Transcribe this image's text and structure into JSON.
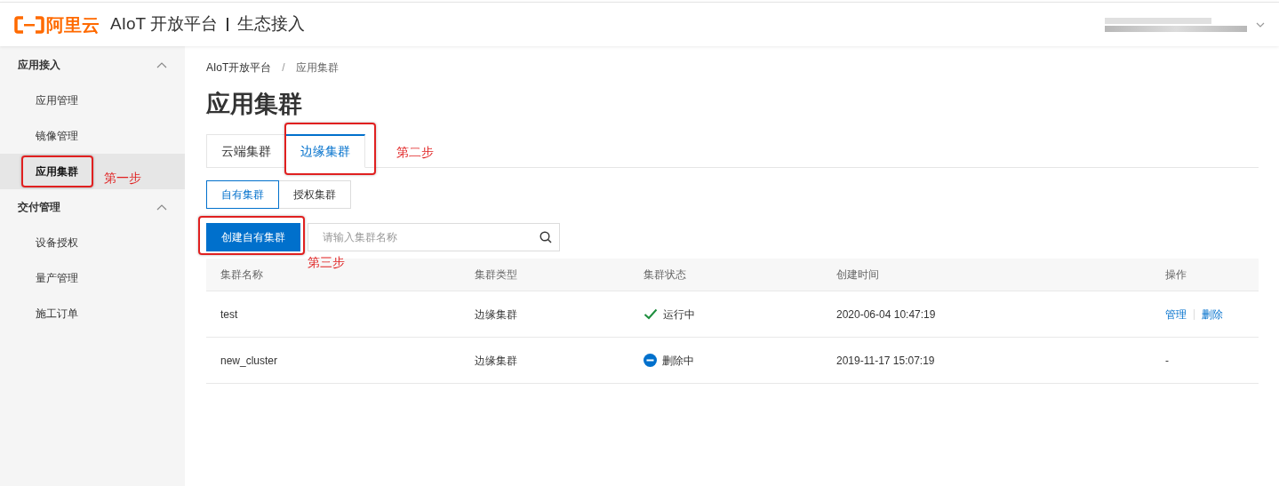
{
  "header": {
    "brand": "阿里云",
    "title": "AIoT 开放平台",
    "subtitle": "生态接入"
  },
  "sidebar": [
    {
      "label": "应用接入",
      "expanded": true,
      "items": [
        {
          "label": "应用管理",
          "selected": false
        },
        {
          "label": "镜像管理",
          "selected": false
        },
        {
          "label": "应用集群",
          "selected": true,
          "annotation": "第一步"
        }
      ]
    },
    {
      "label": "交付管理",
      "expanded": true,
      "items": [
        {
          "label": "设备授权",
          "selected": false
        },
        {
          "label": "量产管理",
          "selected": false
        },
        {
          "label": "施工订单",
          "selected": false
        }
      ]
    }
  ],
  "breadcrumb": {
    "separator": "/",
    "items": [
      "AIoT开放平台",
      "应用集群"
    ]
  },
  "page_title": "应用集群",
  "tabs": [
    {
      "label": "云端集群",
      "selected": false
    },
    {
      "label": "边缘集群",
      "selected": true,
      "annotation": "第二步"
    }
  ],
  "sub_tabs": [
    {
      "label": "自有集群",
      "selected": true
    },
    {
      "label": "授权集群",
      "selected": false
    }
  ],
  "create_button": {
    "label": "创建自有集群",
    "annotation": "第三步"
  },
  "search": {
    "placeholder": "请输入集群名称"
  },
  "table": {
    "columns": [
      "集群名称",
      "集群类型",
      "集群状态",
      "创建时间",
      "操作"
    ],
    "rows": [
      {
        "name": "test",
        "type": "边缘集群",
        "status": {
          "kind": "running",
          "label": "运行中"
        },
        "created": "2020-06-04 10:47:19",
        "actions": [
          "管理",
          "删除"
        ]
      },
      {
        "name": "new_cluster",
        "type": "边缘集群",
        "status": {
          "kind": "deleting",
          "label": "删除中"
        },
        "created": "2019-11-17 15:07:19",
        "no_action": "-"
      }
    ]
  }
}
